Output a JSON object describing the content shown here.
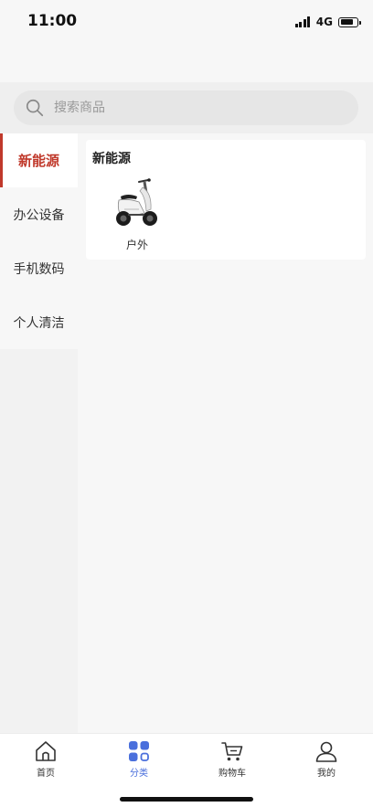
{
  "status": {
    "time": "11:00",
    "network": "4G",
    "battery_level": 0.7
  },
  "search": {
    "placeholder": "搜索商品"
  },
  "sidebar": {
    "items": [
      {
        "label": "新能源",
        "active": true
      },
      {
        "label": "办公设备",
        "active": false
      },
      {
        "label": "手机数码",
        "active": false
      },
      {
        "label": "个人清洁",
        "active": false
      }
    ]
  },
  "content": {
    "section_title": "新能源",
    "products": [
      {
        "label": "户外",
        "icon": "scooter-icon"
      }
    ]
  },
  "tabbar": {
    "items": [
      {
        "label": "首页",
        "icon": "home-icon",
        "active": false
      },
      {
        "label": "分类",
        "icon": "category-icon",
        "active": true
      },
      {
        "label": "购物车",
        "icon": "cart-icon",
        "active": false
      },
      {
        "label": "我的",
        "icon": "profile-icon",
        "active": false
      }
    ]
  },
  "colors": {
    "accent_red": "#c0392b",
    "active_blue": "#4a6fdc"
  }
}
